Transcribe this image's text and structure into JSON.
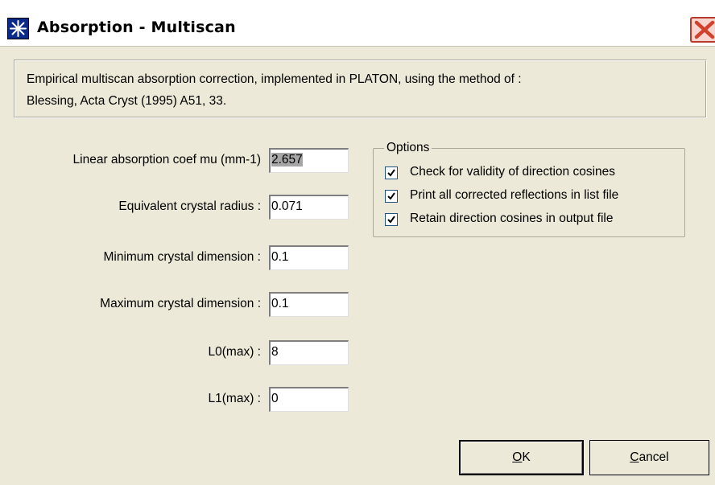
{
  "window": {
    "title": "Absorption - Multiscan",
    "app_icon": "star-icon",
    "close_icon": "close-icon"
  },
  "description": {
    "line1": "Empirical multiscan absorption correction, implemented in PLATON, using the method of :",
    "line2": "Blessing, Acta Cryst (1995) A51, 33."
  },
  "fields": [
    {
      "label": "Linear absorption coef mu (mm-1)",
      "value": "2.657",
      "selected": true
    },
    {
      "label": "Equivalent crystal radius :",
      "value": "0.071"
    },
    {
      "label": "Minimum crystal dimension :",
      "value": "0.1"
    },
    {
      "label": "Maximum crystal dimension :",
      "value": "0.1"
    },
    {
      "label": "L0(max) :",
      "value": "8"
    },
    {
      "label": "L1(max) :",
      "value": "0"
    }
  ],
  "options": {
    "legend": "Options",
    "items": [
      {
        "label": "Check for validity of direction cosines",
        "checked": true
      },
      {
        "label": "Print all corrected reflections in list file",
        "checked": true
      },
      {
        "label": "Retain direction cosines in output file",
        "checked": true
      }
    ]
  },
  "buttons": {
    "ok_accel": "O",
    "ok_rest": "K",
    "cancel_accel": "C",
    "cancel_rest": "ancel"
  }
}
